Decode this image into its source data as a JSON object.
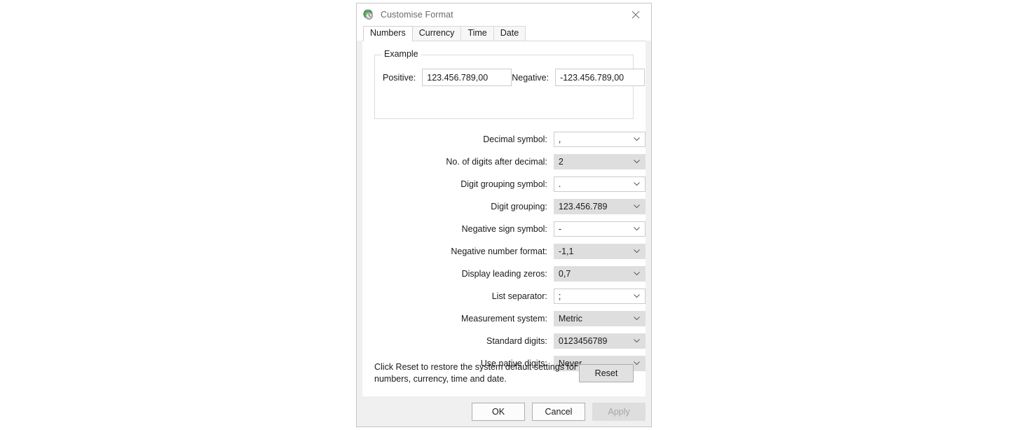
{
  "window": {
    "title": "Customise Format",
    "icon": "region-globe-icon",
    "close_label": "✕"
  },
  "tabs": [
    {
      "label": "Numbers",
      "active": true
    },
    {
      "label": "Currency",
      "active": false
    },
    {
      "label": "Time",
      "active": false
    },
    {
      "label": "Date",
      "active": false
    }
  ],
  "example": {
    "legend": "Example",
    "positive_label": "Positive:",
    "positive_value": "123.456.789,00",
    "negative_label": "Negative:",
    "negative_value": "-123.456.789,00"
  },
  "settings": [
    {
      "label": "Decimal symbol:",
      "value": ",",
      "style": "editable"
    },
    {
      "label": "No. of digits after decimal:",
      "value": "2",
      "style": "readonly"
    },
    {
      "label": "Digit grouping symbol:",
      "value": ".",
      "style": "editable"
    },
    {
      "label": "Digit grouping:",
      "value": "123.456.789",
      "style": "readonly"
    },
    {
      "label": "Negative sign symbol:",
      "value": "-",
      "style": "editable"
    },
    {
      "label": "Negative number format:",
      "value": "-1,1",
      "style": "readonly"
    },
    {
      "label": "Display leading zeros:",
      "value": "0,7",
      "style": "readonly"
    },
    {
      "label": "List separator:",
      "value": ";",
      "style": "editable"
    },
    {
      "label": "Measurement system:",
      "value": "Metric",
      "style": "readonly"
    },
    {
      "label": "Standard digits:",
      "value": "0123456789",
      "style": "readonly"
    },
    {
      "label": "Use native digits:",
      "value": "Never",
      "style": "readonly"
    }
  ],
  "reset": {
    "text": "Click Reset to restore the system default settings for numbers, currency, time and date.",
    "button_label": "Reset"
  },
  "footer": {
    "ok_label": "OK",
    "cancel_label": "Cancel",
    "apply_label": "Apply",
    "apply_disabled": true
  },
  "colors": {
    "dialog_bg": "#f0f0f0",
    "panel_bg": "#ffffff",
    "combo_readonly_bg": "#dedede",
    "text": "#1a1a1a",
    "title_text": "#6b6b6b"
  }
}
